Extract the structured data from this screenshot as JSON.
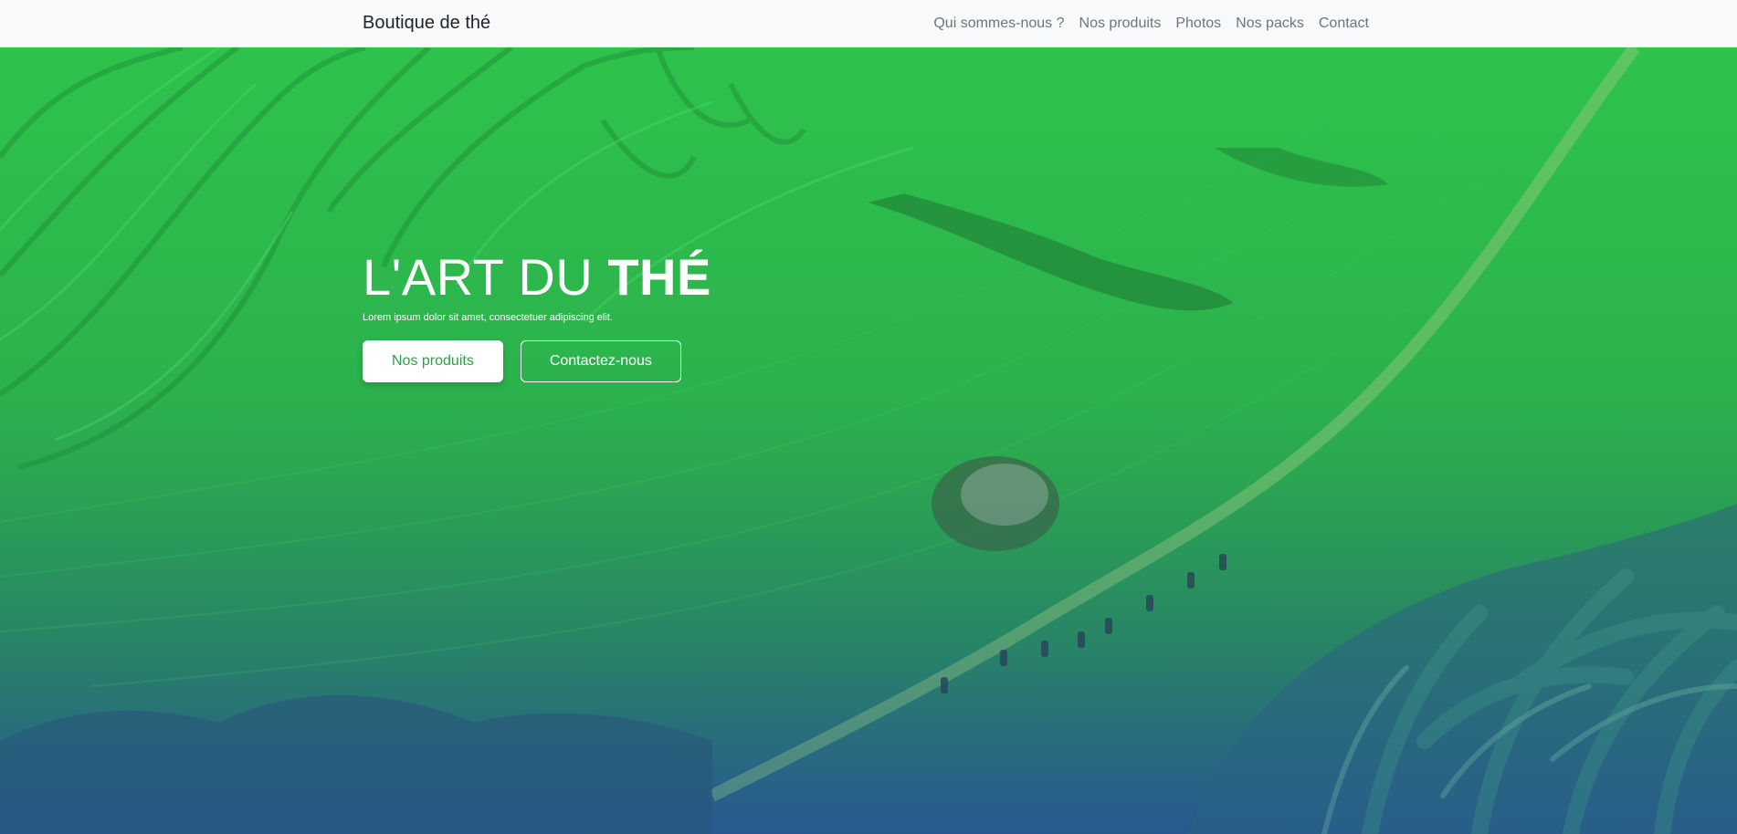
{
  "navbar": {
    "brand": "Boutique de thé",
    "links": [
      "Qui sommes-nous ?",
      "Nos produits",
      "Photos",
      "Nos packs",
      "Contact"
    ]
  },
  "hero": {
    "title_light": "L'ART DU ",
    "title_bold": "THÉ",
    "subtitle": "Lorem ipsum dolor sit amet, consectetuer adipiscing elit.",
    "primary_button": "Nos produits",
    "secondary_button": "Contactez-nous"
  },
  "colors": {
    "accent": "#2e9e45",
    "navbar_bg": "#f8f9fa",
    "nav_link": "#6c757d"
  }
}
